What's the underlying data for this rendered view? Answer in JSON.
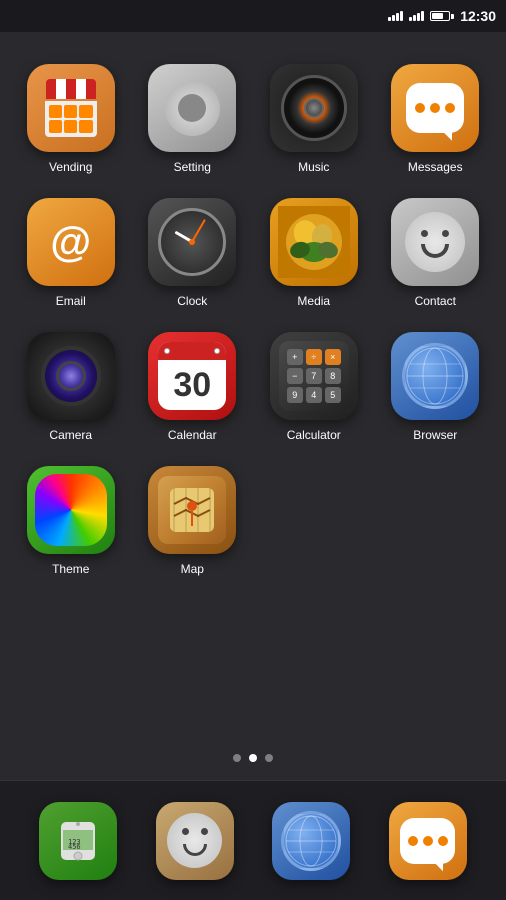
{
  "statusBar": {
    "time": "12:30"
  },
  "apps": [
    {
      "id": "vending",
      "label": "Vending",
      "iconType": "vending"
    },
    {
      "id": "setting",
      "label": "Setting",
      "iconType": "setting"
    },
    {
      "id": "music",
      "label": "Music",
      "iconType": "music"
    },
    {
      "id": "messages",
      "label": "Messages",
      "iconType": "messages"
    },
    {
      "id": "email",
      "label": "Email",
      "iconType": "email"
    },
    {
      "id": "clock",
      "label": "Clock",
      "iconType": "clock"
    },
    {
      "id": "media",
      "label": "Media",
      "iconType": "media"
    },
    {
      "id": "contact",
      "label": "Contact",
      "iconType": "contact"
    },
    {
      "id": "camera",
      "label": "Camera",
      "iconType": "camera"
    },
    {
      "id": "calendar",
      "label": "Calendar",
      "iconType": "calendar"
    },
    {
      "id": "calculator",
      "label": "Calculator",
      "iconType": "calculator"
    },
    {
      "id": "browser",
      "label": "Browser",
      "iconType": "browser"
    },
    {
      "id": "theme",
      "label": "Theme",
      "iconType": "theme"
    },
    {
      "id": "map",
      "label": "Map",
      "iconType": "map"
    }
  ],
  "dock": [
    {
      "id": "phone",
      "label": "Phone"
    },
    {
      "id": "contact",
      "label": "Contact"
    },
    {
      "id": "browser",
      "label": "Browser"
    },
    {
      "id": "messages",
      "label": "Messages"
    }
  ],
  "pageDots": [
    {
      "active": false
    },
    {
      "active": true
    },
    {
      "active": false
    }
  ]
}
